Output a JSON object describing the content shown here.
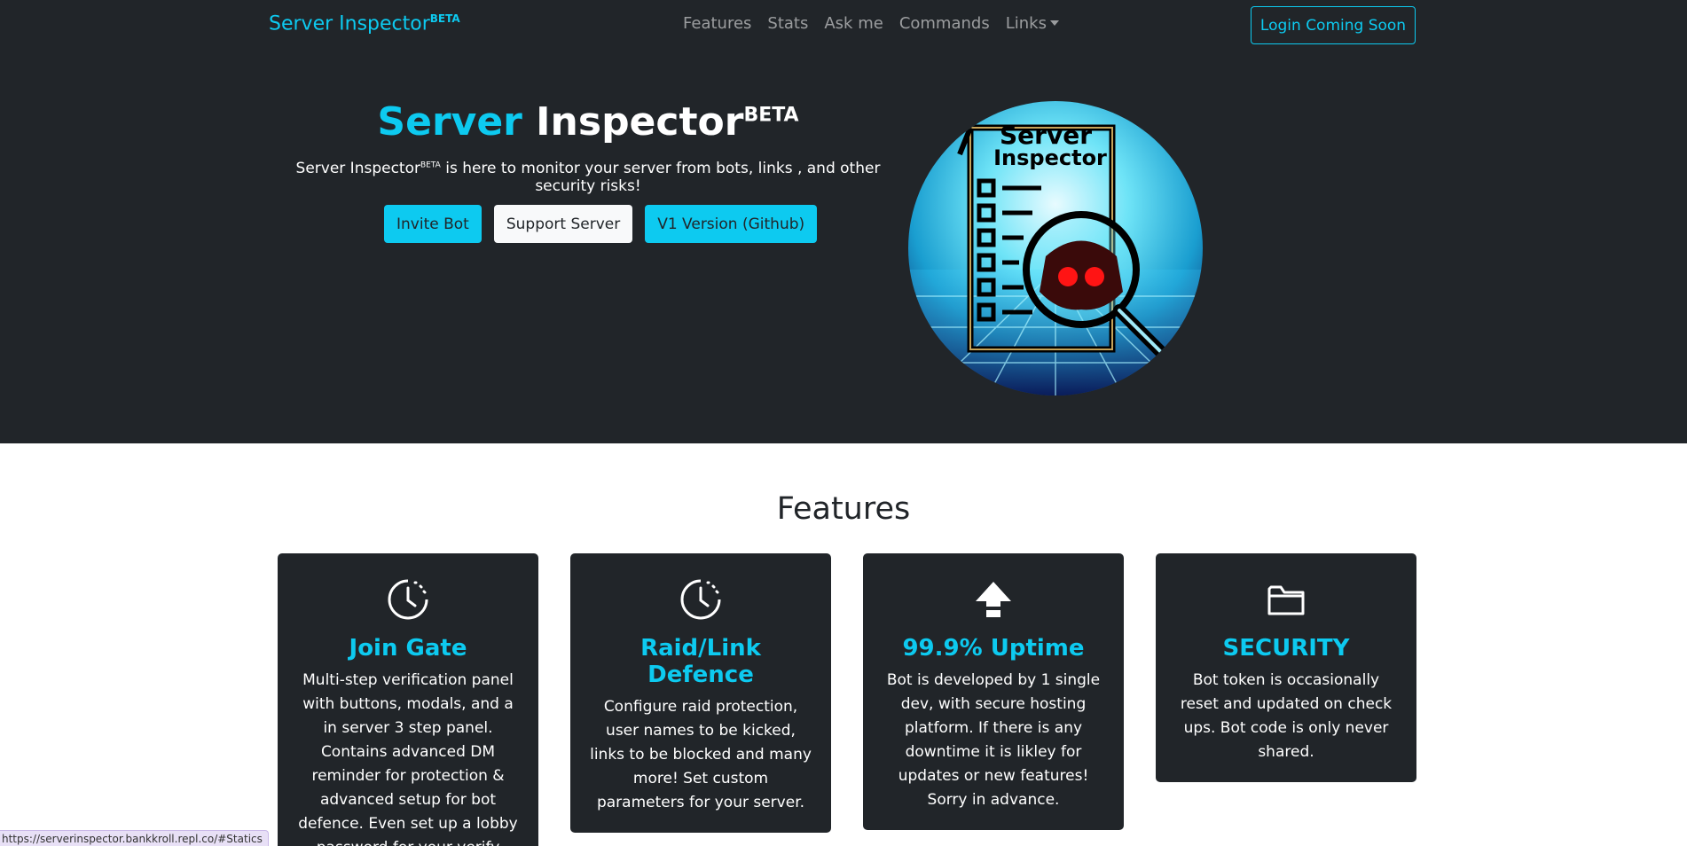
{
  "navbar": {
    "brand": "Server Inspector",
    "brand_sup": "BETA",
    "links": [
      "Features",
      "Stats",
      "Ask me",
      "Commands",
      "Links"
    ],
    "login": "Login Coming Soon"
  },
  "hero": {
    "title_accent": "Server",
    "title_main": " Inspector",
    "title_sup": "BETA",
    "subtitle_name": "Server Inspector",
    "subtitle_sup": "BETA",
    "subtitle_rest": " is here to monitor your server from bots, links , and other security risks!",
    "buttons": {
      "invite": "Invite Bot",
      "support": "Support Server",
      "github": "V1 Version (Github)"
    },
    "logo_text_1": "Server",
    "logo_text_2": "Inspector"
  },
  "features": {
    "title": "Features",
    "cards": [
      {
        "icon": "clock-icon",
        "title": "Join Gate",
        "text": "Multi-step verification panel with buttons, modals, and a in server 3 step panel. Contains advanced DM reminder for protection & advanced setup for bot defence. Even set up a lobby password for your verify"
      },
      {
        "icon": "clock-icon",
        "title": "Raid/Link Defence",
        "text": "Configure raid protection, user names to be kicked, links to be blocked and many more! Set custom parameters for your server."
      },
      {
        "icon": "upload-arrow-icon",
        "title": "99.9% Uptime",
        "text": "Bot is developed by 1 single dev, with secure hosting platform. If there is any downtime it is likley for updates or new features! Sorry in advance."
      },
      {
        "icon": "folder-icon",
        "title": "SECURITY",
        "text": "Bot token is occasionally reset and updated on check ups. Bot code is only never shared."
      }
    ]
  },
  "status_bar": {
    "url": "https://serverinspector.bankkroll.repl.co/#Statics"
  },
  "colors": {
    "accent": "#0dcaf0",
    "dark": "#212529",
    "light": "#f8f9fa"
  }
}
